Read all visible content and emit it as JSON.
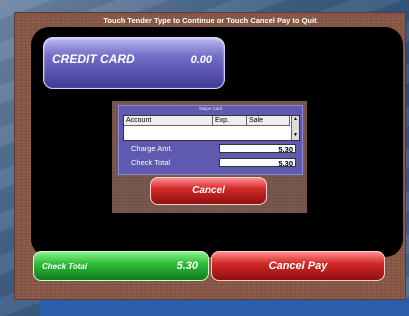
{
  "header": {
    "title": "Touch Tender Type to Continue or Touch Cancel Pay to Quit"
  },
  "tender": {
    "label": "CREDIT CARD",
    "amount": "0.00"
  },
  "dialog": {
    "title": "Swipe Card",
    "columns": [
      "Account",
      "Exp.",
      "Sale"
    ],
    "charge_amt_label": "Charge Amt.",
    "charge_amt_value": "5.30",
    "check_total_label": "Check Total",
    "check_total_value": "5.30",
    "cancel_label": "Cancel"
  },
  "footer": {
    "check_total_label": "Check Total",
    "check_total_amount": "5.30",
    "cancel_pay_label": "Cancel Pay"
  },
  "colors": {
    "tender_button": "#5a56c0",
    "cancel": "#d52a2a",
    "check_total": "#2fbf3a"
  }
}
